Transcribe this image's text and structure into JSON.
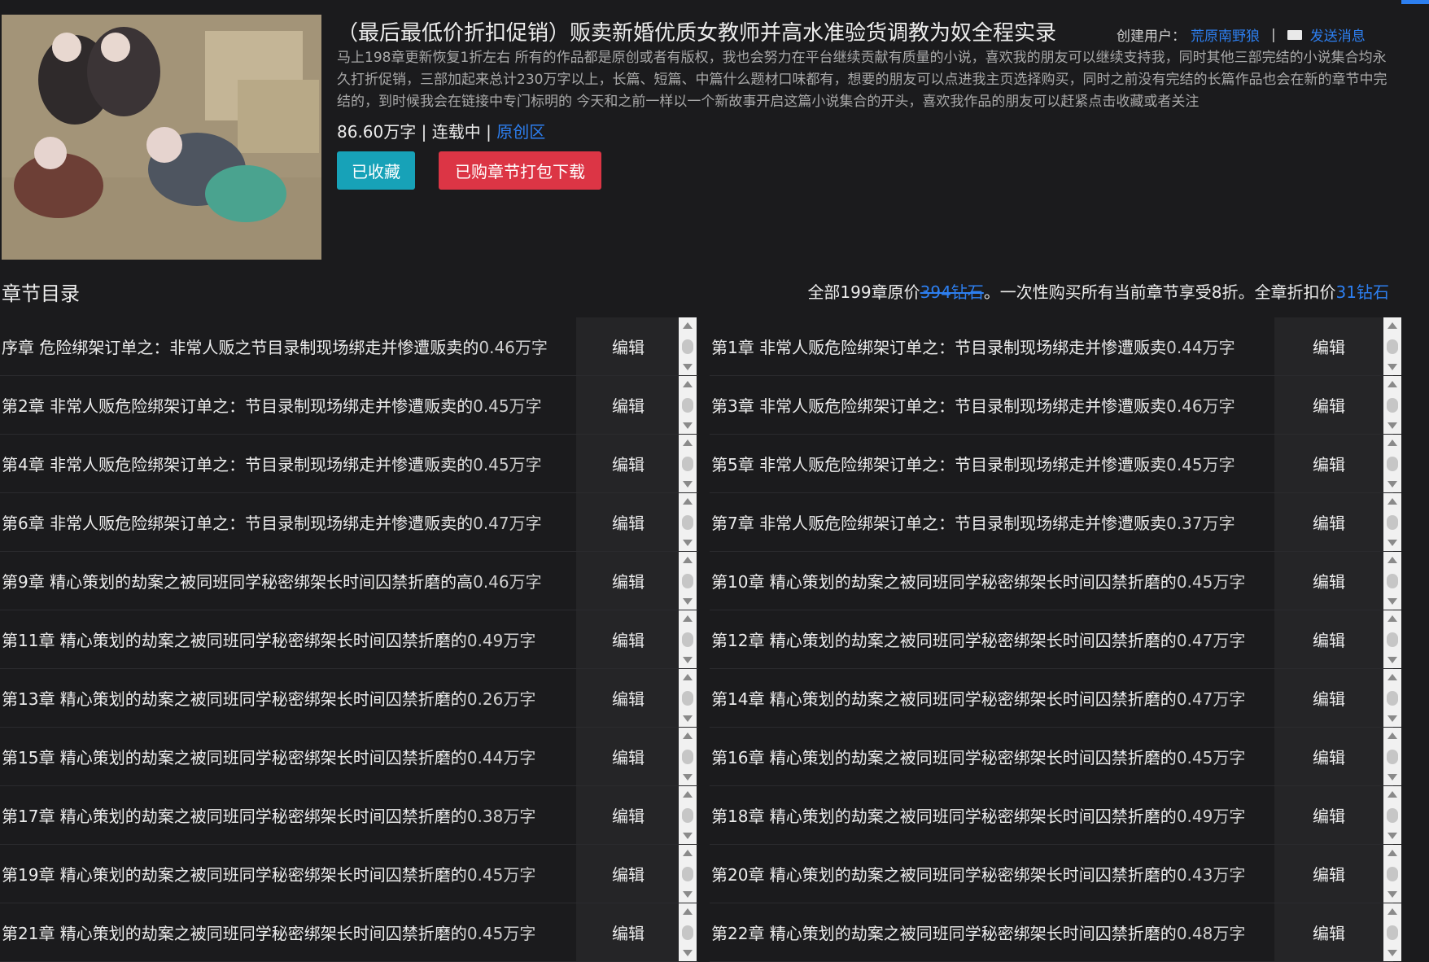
{
  "book": {
    "title": "（最后最低价折扣促销）贩卖新婚优质女教师并高水准验货调教为奴全程实录",
    "creator_label": "创建用户：",
    "creator_name": "荒原南野狼",
    "separator": "|",
    "message_label": "发送消息",
    "description": "马上198章更新恢复1折左右 所有的作品都是原创或者有版权，我也会努力在平台继续贡献有质量的小说，喜欢我的朋友可以继续支持我，同时其他三部完结的小说集合均永久打折促销，三部加起来总计230万字以上，长篇、短篇、中篇什么题材口味都有，想要的朋友可以点进我主页选择购买，同时之前没有完结的长篇作品也会在新的章节中完结的，到时候我会在链接中专门标明的 今天和之前一样以一个新故事开启这篇小说集合的开头，喜欢我作品的朋友可以赶紧点击收藏或者关注",
    "word_count": "86.60万字",
    "status": "连载中",
    "category": "原创区",
    "favorite_button": "已收藏",
    "download_button": "已购章节打包下载"
  },
  "toc": {
    "title": "章节目录",
    "price_prefix": "全部199章原价",
    "price_original": "394钻石",
    "price_middle": "。一次性购买所有当前章节享受8折。全章折扣价",
    "price_discount": "31钻石"
  },
  "edit_label": "编辑",
  "rows": [
    {
      "left": {
        "name": "序章 危险绑架订单之：非常人贩之节目录制现场绑走并惨遭贩卖的",
        "wc": "0.46万字"
      },
      "right": {
        "name": "第1章 非常人贩危险绑架订单之：节目录制现场绑走并惨遭贩卖",
        "wc": "0.44万字"
      }
    },
    {
      "left": {
        "name": "第2章 非常人贩危险绑架订单之：节目录制现场绑走并惨遭贩卖的",
        "wc": "0.45万字"
      },
      "right": {
        "name": "第3章 非常人贩危险绑架订单之：节目录制现场绑走并惨遭贩卖",
        "wc": "0.46万字"
      }
    },
    {
      "left": {
        "name": "第4章 非常人贩危险绑架订单之：节目录制现场绑走并惨遭贩卖的",
        "wc": "0.45万字"
      },
      "right": {
        "name": "第5章 非常人贩危险绑架订单之：节目录制现场绑走并惨遭贩卖",
        "wc": "0.45万字"
      }
    },
    {
      "left": {
        "name": "第6章 非常人贩危险绑架订单之：节目录制现场绑走并惨遭贩卖的",
        "wc": "0.47万字"
      },
      "right": {
        "name": "第7章 非常人贩危险绑架订单之：节目录制现场绑走并惨遭贩卖",
        "wc": "0.37万字"
      }
    },
    {
      "left": {
        "name": "第9章 精心策划的劫案之被同班同学秘密绑架长时间囚禁折磨的高",
        "wc": "0.46万字"
      },
      "right": {
        "name": "第10章 精心策划的劫案之被同班同学秘密绑架长时间囚禁折磨的",
        "wc": "0.45万字"
      }
    },
    {
      "left": {
        "name": "第11章 精心策划的劫案之被同班同学秘密绑架长时间囚禁折磨的",
        "wc": "0.49万字"
      },
      "right": {
        "name": "第12章 精心策划的劫案之被同班同学秘密绑架长时间囚禁折磨的",
        "wc": "0.47万字"
      }
    },
    {
      "left": {
        "name": "第13章 精心策划的劫案之被同班同学秘密绑架长时间囚禁折磨的",
        "wc": "0.26万字"
      },
      "right": {
        "name": "第14章 精心策划的劫案之被同班同学秘密绑架长时间囚禁折磨的",
        "wc": "0.47万字"
      }
    },
    {
      "left": {
        "name": "第15章 精心策划的劫案之被同班同学秘密绑架长时间囚禁折磨的",
        "wc": "0.44万字"
      },
      "right": {
        "name": "第16章 精心策划的劫案之被同班同学秘密绑架长时间囚禁折磨的",
        "wc": "0.45万字"
      }
    },
    {
      "left": {
        "name": "第17章 精心策划的劫案之被同班同学秘密绑架长时间囚禁折磨的",
        "wc": "0.38万字"
      },
      "right": {
        "name": "第18章 精心策划的劫案之被同班同学秘密绑架长时间囚禁折磨的",
        "wc": "0.49万字"
      }
    },
    {
      "left": {
        "name": "第19章 精心策划的劫案之被同班同学秘密绑架长时间囚禁折磨的",
        "wc": "0.45万字"
      },
      "right": {
        "name": "第20章 精心策划的劫案之被同班同学秘密绑架长时间囚禁折磨的",
        "wc": "0.43万字"
      }
    },
    {
      "left": {
        "name": "第21章 精心策划的劫案之被同班同学秘密绑架长时间囚禁折磨的",
        "wc": "0.45万字"
      },
      "right": {
        "name": "第22章 精心策划的劫案之被同班同学秘密绑架长时间囚禁折磨的",
        "wc": "0.48万字"
      }
    }
  ],
  "colors": {
    "link": "#2d7ff0",
    "favorite": "#17a2b8",
    "download": "#dc3545"
  }
}
